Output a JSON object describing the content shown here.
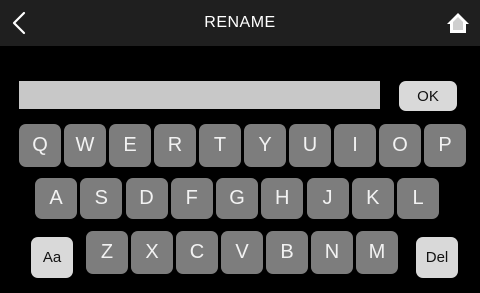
{
  "header": {
    "title": "RENAME",
    "back_icon": "chevron-left-icon",
    "home_icon": "home-icon"
  },
  "name_field": {
    "value": "",
    "placeholder": ""
  },
  "ok_label": "OK",
  "keyboard": {
    "row1": [
      "Q",
      "W",
      "E",
      "R",
      "T",
      "Y",
      "U",
      "I",
      "O",
      "P"
    ],
    "row2": [
      "A",
      "S",
      "D",
      "F",
      "G",
      "H",
      "J",
      "K",
      "L"
    ],
    "row3": [
      "Z",
      "X",
      "C",
      "V",
      "B",
      "N",
      "M"
    ],
    "case_label": "Aa",
    "delete_label": "Del"
  },
  "colors": {
    "background": "#000000",
    "header": "#1f1f1f",
    "key": "#7d7d7d",
    "key_light": "#d9d9d9",
    "field": "#c8c8c8"
  }
}
